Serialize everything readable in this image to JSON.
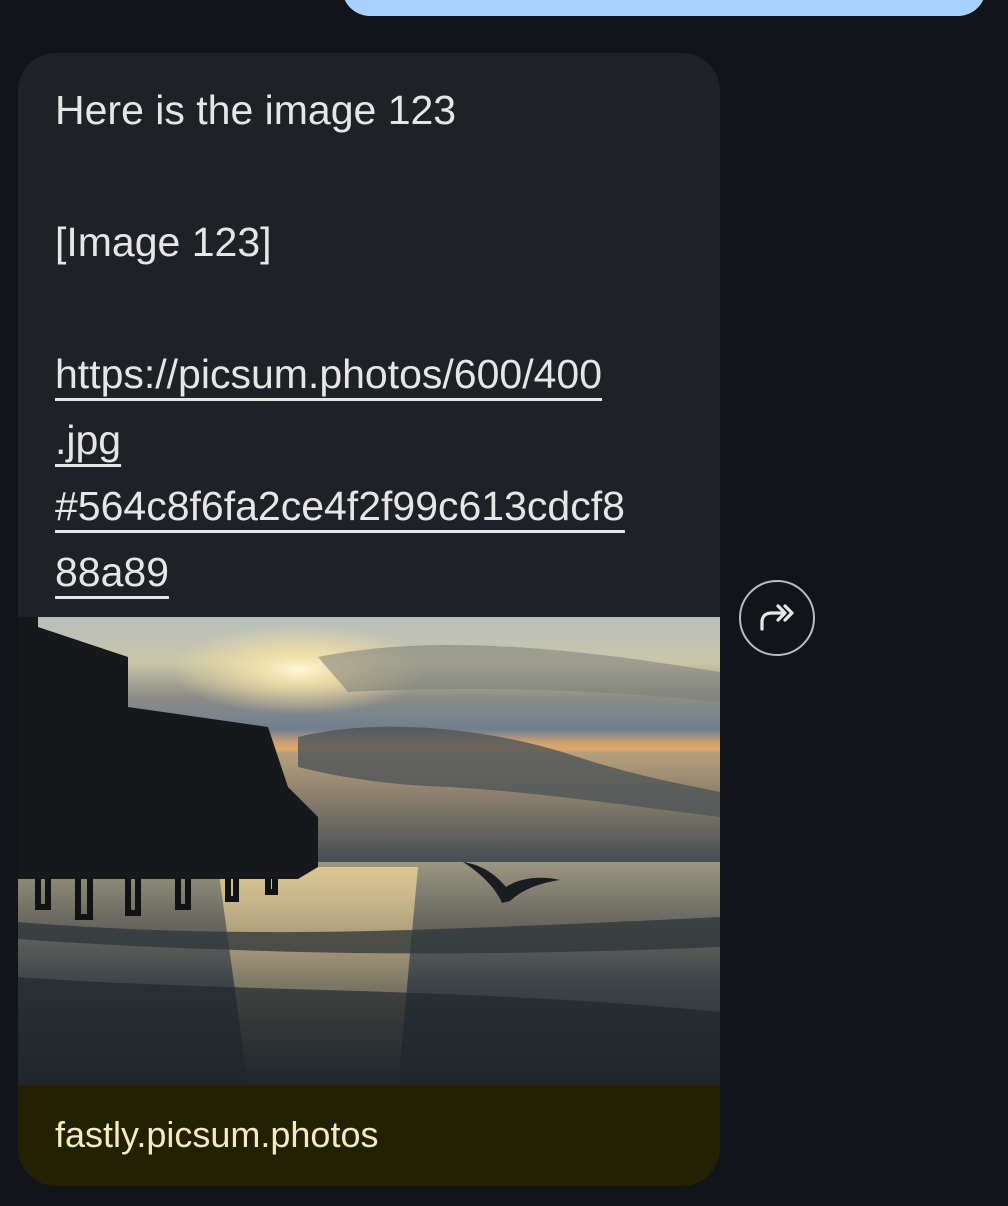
{
  "message": {
    "line1": "Here is the image 123",
    "line2": "[Image 123]",
    "url_lines": [
      "https://picsum.photos/600/400",
      ".jpg",
      "#564c8f6fa2ce4f2f99c613cdcf8",
      "88a89"
    ]
  },
  "link_preview": {
    "domain": "fastly.picsum.photos"
  },
  "actions": {
    "forward_icon": "forward-icon"
  },
  "colors": {
    "background": "#111418",
    "sent_bubble": "#a8d1ff",
    "received_bubble": "#1e2125",
    "preview_footer": "#232003"
  }
}
